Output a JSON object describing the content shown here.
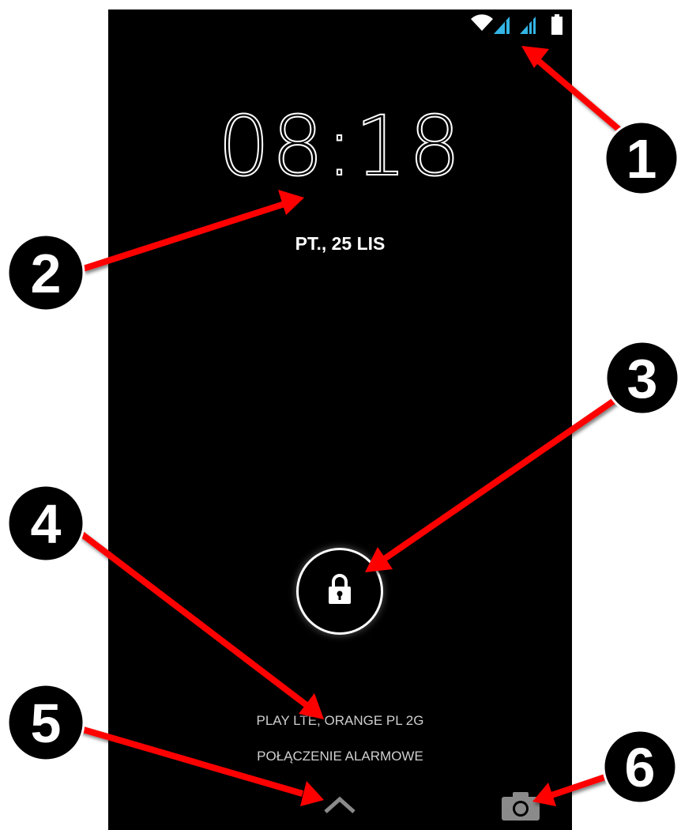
{
  "lock_screen": {
    "time_hours": "08",
    "time_colon": ":",
    "time_minutes": "18",
    "date": "PT., 25 LIS",
    "carrier": "PLAY LTE, ORANGE PL 2G",
    "emergency_call": "POŁĄCZENIE ALARMOWE"
  },
  "status_bar": {
    "icons": [
      "wifi-icon",
      "signal-icon",
      "signal-icon",
      "battery-icon"
    ],
    "signal_color": "#33b5e5"
  },
  "callouts": {
    "n1": "1",
    "n2": "2",
    "n3": "3",
    "n4": "4",
    "n5": "5",
    "n6": "6",
    "arrow_color": "#ff0000"
  }
}
